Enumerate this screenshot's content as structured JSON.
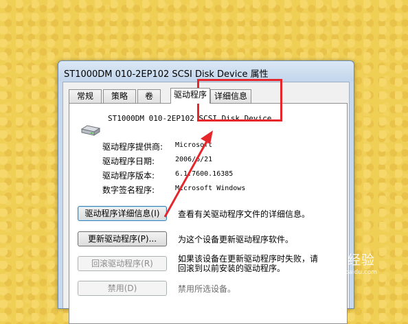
{
  "window": {
    "title": "ST1000DM 010-2EP102 SCSI Disk Device 属性"
  },
  "tabs": [
    {
      "label": "常规"
    },
    {
      "label": "策略"
    },
    {
      "label": "卷"
    },
    {
      "label": "驱动程序"
    },
    {
      "label": "详细信息"
    }
  ],
  "active_tab": "驱动程序",
  "device": {
    "name": "ST1000DM 010-2EP102 SCSI Disk Device",
    "icon": "hard-drive-icon"
  },
  "info": [
    {
      "label": "驱动程序提供商:",
      "value": "Microsoft"
    },
    {
      "label": "驱动程序日期:",
      "value": "2006/6/21"
    },
    {
      "label": "驱动程序版本:",
      "value": "6.1.7600.16385"
    },
    {
      "label": "数字签名程序:",
      "value": "Microsoft Windows"
    }
  ],
  "actions": [
    {
      "button": "驱动程序详细信息(I)",
      "description": "查看有关驱动程序文件的详细信息。"
    },
    {
      "button": "更新驱动程序(P)...",
      "description": "为这个设备更新驱动程序软件。"
    },
    {
      "button": "回滚驱动程序(R)",
      "description_line1": "如果该设备在更新驱动程序时失败，请",
      "description_line2": "回滚到以前安装的驱动程序。"
    },
    {
      "button": "禁用(D)",
      "description": "禁用所选设备。"
    }
  ],
  "annotation": {
    "highlight_color": "#e5262b"
  },
  "watermark": {
    "text": "Bai 经验",
    "sub": "jingyan.baidu.com"
  }
}
